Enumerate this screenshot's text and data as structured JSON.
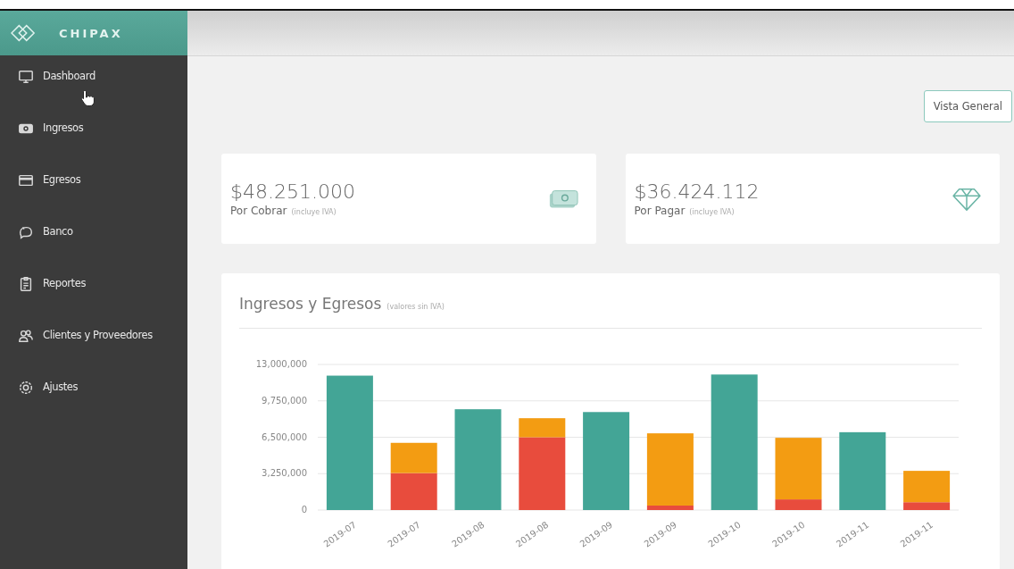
{
  "sidebar": {
    "brand": "CHIPAX",
    "items": [
      {
        "label": "Dashboard",
        "kind": "monitor"
      },
      {
        "label": "Ingresos",
        "kind": "money"
      },
      {
        "label": "Egresos",
        "kind": "card"
      },
      {
        "label": "Banco",
        "kind": "piggy"
      },
      {
        "label": "Reportes",
        "kind": "clipboard"
      },
      {
        "label": "Clientes y Proveedores",
        "kind": "people"
      },
      {
        "label": "Ajustes",
        "kind": "gear"
      }
    ]
  },
  "view_button": "Vista General",
  "summary_cards": [
    {
      "amount": "$48.251.000",
      "label": "Por Cobrar",
      "note": "(incluye IVA)",
      "kind": "money"
    },
    {
      "amount": "$36.424.112",
      "label": "Por Pagar",
      "note": "(incluye IVA)",
      "kind": "diamond"
    }
  ],
  "chart_card": {
    "title": "Ingresos y Egresos",
    "note": "(valores sin IVA)",
    "chart_data": {
      "type": "bar",
      "stacked": true,
      "grid": true,
      "categories": [
        "2019-07",
        "2019-07",
        "2019-08",
        "2019-08",
        "2019-09",
        "2019-09",
        "2019-10",
        "2019-10",
        "2019-11",
        "2019-11"
      ],
      "series": [
        {
          "color": "#43a596",
          "values": [
            12000000,
            null,
            9000000,
            null,
            8750000,
            null,
            12100000,
            null,
            6950000,
            null
          ]
        },
        {
          "color": "#e84c3d",
          "values": [
            null,
            3300000,
            null,
            6500000,
            null,
            400000,
            null,
            950000,
            null,
            700000
          ]
        },
        {
          "color": "#f39c12",
          "values": [
            null,
            2700000,
            null,
            1700000,
            null,
            6450000,
            null,
            5500000,
            null,
            2800000
          ]
        }
      ],
      "ylim": [
        0,
        13000000
      ],
      "yticks": [
        {
          "value": 0,
          "label": "0"
        },
        {
          "value": 3250000,
          "label": "3,250,000"
        },
        {
          "value": 6500000,
          "label": "6,500,000"
        },
        {
          "value": 9750000,
          "label": "9,750,000"
        },
        {
          "value": 13000000,
          "label": "13,000,000"
        }
      ]
    }
  }
}
